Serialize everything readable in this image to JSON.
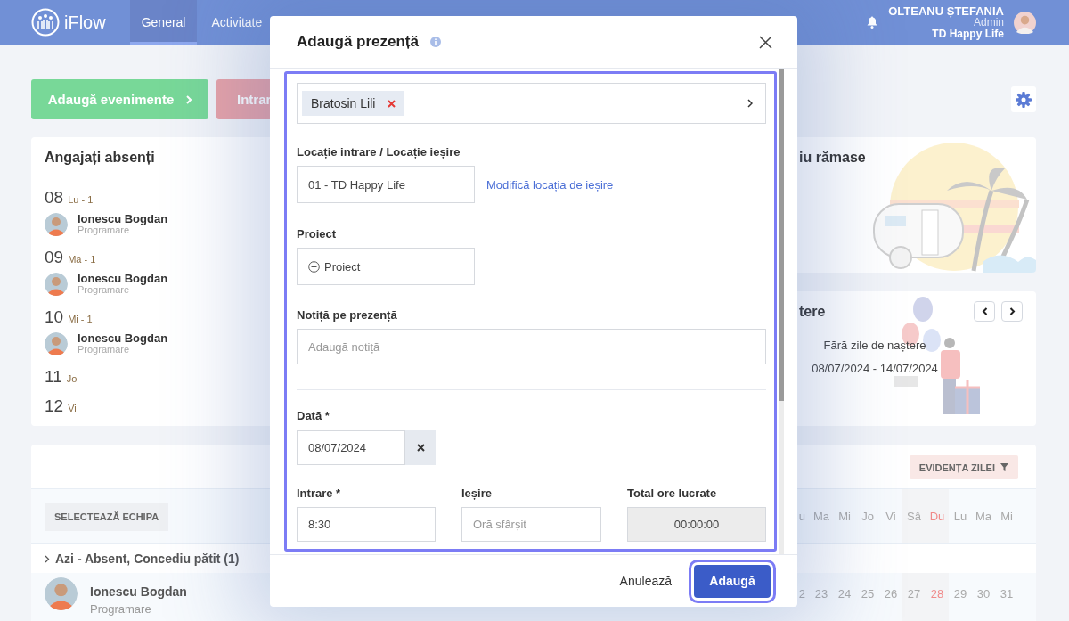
{
  "header": {
    "logo": "iFlow",
    "nav": [
      {
        "label": "General",
        "selected": true
      },
      {
        "label": "Activitate",
        "selected": false
      }
    ],
    "user": {
      "name": "OLTEANU ȘTEFANIA",
      "role": "Admin",
      "company": "TD Happy Life"
    }
  },
  "actions": [
    {
      "label": "Adaugă evenimente",
      "kind": "success"
    },
    {
      "label": "Intrar",
      "kind": "danger"
    }
  ],
  "absent_card": {
    "title": "Angajați absenți",
    "days": [
      {
        "day": "08",
        "weekday": "Lu - 1",
        "people": [
          {
            "name": "Ionescu Bogdan",
            "detail": "Programare"
          }
        ]
      },
      {
        "day": "09",
        "weekday": "Ma - 1",
        "people": [
          {
            "name": "Ionescu Bogdan",
            "detail": "Programare"
          }
        ]
      },
      {
        "day": "10",
        "weekday": "Mi - 1",
        "people": [
          {
            "name": "Ionescu Bogdan",
            "detail": "Programare"
          }
        ]
      },
      {
        "day": "11",
        "weekday": "Jo"
      },
      {
        "day": "12",
        "weekday": "Vi"
      }
    ]
  },
  "leave_card": {
    "title": "iu rămase"
  },
  "birthday_card": {
    "title": "tere",
    "message": "Fără zile de naștere",
    "range": "08/07/2024 - 14/07/2024"
  },
  "attendance": {
    "team_button": "SELECTEAZĂ ECHIPA",
    "filter_button": "EVIDENȚA ZILEI",
    "weekdays": [
      {
        "label": "u",
        "kind": "weekday"
      },
      {
        "label": "Ma",
        "kind": "weekday"
      },
      {
        "label": "Mi",
        "kind": "weekday"
      },
      {
        "label": "Jo",
        "kind": "weekday"
      },
      {
        "label": "Vi",
        "kind": "weekday"
      },
      {
        "label": "Sâ",
        "kind": "saturday"
      },
      {
        "label": "Du",
        "kind": "sunday"
      },
      {
        "label": "Lu",
        "kind": "weekday"
      },
      {
        "label": "Ma",
        "kind": "weekday"
      },
      {
        "label": "Mi",
        "kind": "weekday"
      }
    ],
    "group": {
      "label": "Azi - Absent, Concediu pătit (1)",
      "expanded": false
    },
    "rows": [
      {
        "name": "Ionescu Bogdan",
        "detail": "Programare",
        "days": [
          "2",
          "23",
          "24",
          "25",
          "26",
          "27",
          "28",
          "29",
          "30",
          "31"
        ]
      }
    ]
  },
  "modal": {
    "title": "Adaugă prezență",
    "employees": [
      {
        "name": "Bratosin Lili"
      }
    ],
    "location": {
      "label": "Locație intrare / Locație ieșire",
      "value": "01 - TD Happy Life",
      "link": "Modifică locația de ieșire"
    },
    "project": {
      "label": "Proiect",
      "button": "Proiect"
    },
    "note": {
      "label": "Notiță pe prezență",
      "placeholder": "Adaugă notiță"
    },
    "date": {
      "label": "Dată *",
      "value": "08/07/2024"
    },
    "times": [
      {
        "label": "Intrare *",
        "value": "8:30",
        "kind": "input"
      },
      {
        "label": "Ieșire",
        "placeholder": "Oră sfârșit",
        "kind": "input"
      },
      {
        "label": "Total ore lucrate",
        "value": "00:00:00",
        "kind": "readonly"
      }
    ],
    "cancel": "Anulează",
    "submit": "Adaugă"
  }
}
